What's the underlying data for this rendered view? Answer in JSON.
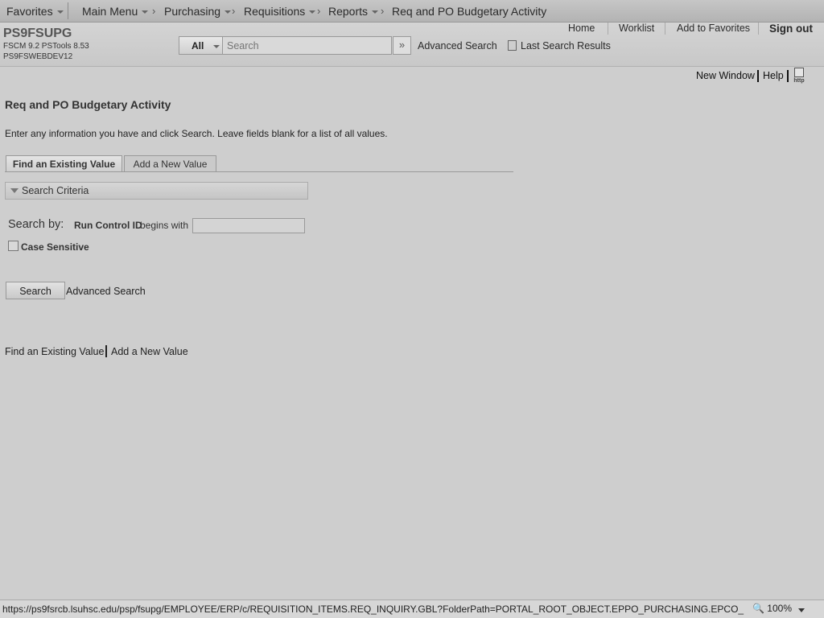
{
  "topnav": {
    "favorites": "Favorites",
    "main_menu": "Main Menu",
    "purchasing": "Purchasing",
    "requisitions": "Requisitions",
    "reports": "Reports",
    "current": "Req and PO Budgetary Activity"
  },
  "header": {
    "system_name": "PS9FSUPG",
    "system_info": "FSCM 9.2   PSTools 8.53",
    "server": "PS9FSWEBDEV12",
    "home": "Home",
    "worklist": "Worklist",
    "add_to_favorites": "Add to Favorites",
    "sign_out": "Sign out"
  },
  "search": {
    "scope": "All",
    "placeholder": "Search",
    "go_icon": "double-chevron-right",
    "advanced": "Advanced Search",
    "last_results": "Last Search Results"
  },
  "pagebar": {
    "new_window": "New Window",
    "help": "Help",
    "http_icon_text": "http"
  },
  "page": {
    "title": "Req and PO Budgetary Activity",
    "instructions": "Enter any information you have and click Search. Leave fields blank for a list of all values.",
    "tab_find": "Find an Existing Value",
    "tab_add": "Add a New Value",
    "criteria_header": "Search Criteria",
    "search_by": "Search by:",
    "field_label": "Run Control ID",
    "operator": "begins with",
    "run_control_value": "",
    "case_sensitive": "Case Sensitive",
    "search_button": "Search",
    "advanced_search": "Advanced Search",
    "bottom_find": "Find an Existing Value",
    "bottom_add": "Add a New Value"
  },
  "statusbar": {
    "url": "https://ps9fsrcb.lsuhsc.edu/psp/fsupg/EMPLOYEE/ERP/c/REQUISITION_ITEMS.REQ_INQUIRY.GBL?FolderPath=PORTAL_ROOT_OBJECT.EPPO_PURCHASING.EPCO_REQUISITIO",
    "zoom": "100%"
  }
}
